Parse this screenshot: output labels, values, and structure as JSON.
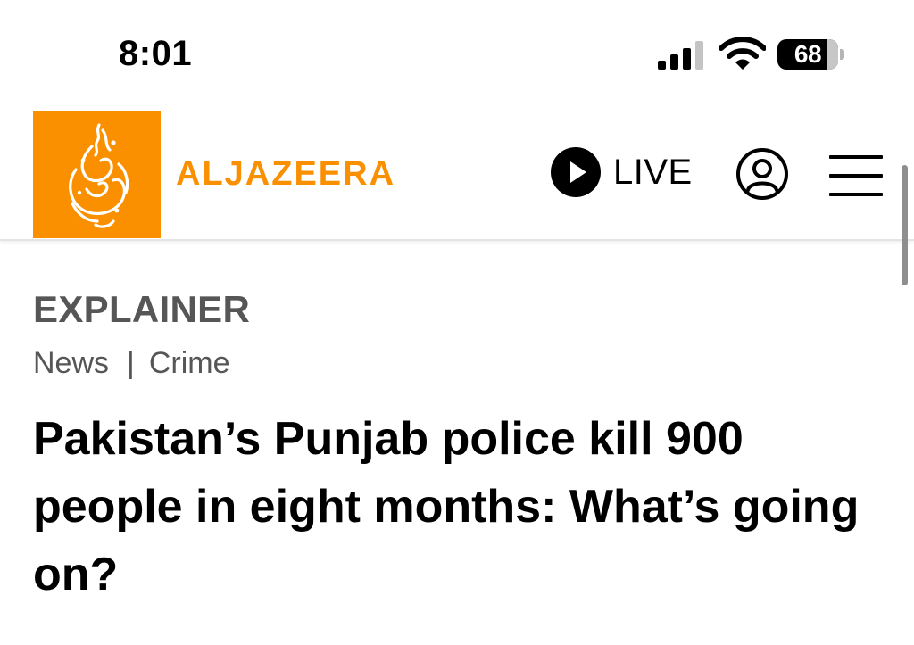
{
  "status_bar": {
    "time": "8:01",
    "battery_level": "68",
    "signal_bars_active": 3,
    "signal_bars_total": 4,
    "icons": [
      "cellular-signal-icon",
      "wifi-icon",
      "battery-icon"
    ]
  },
  "header": {
    "logo_text": "ALJAZEERA",
    "live_label": "LIVE",
    "icons": [
      "al-jazeera-calligraphy-logo",
      "play-icon",
      "account-icon",
      "hamburger-menu-icon"
    ]
  },
  "article": {
    "type_label": "EXPLAINER",
    "breadcrumb": [
      "News",
      "Crime"
    ],
    "breadcrumb_separator": "|",
    "headline": "Pakistan’s Punjab police kill 900 people in eight months: What’s going on?"
  },
  "colors": {
    "brand_orange": "#fa9000",
    "label_gray": "#565656",
    "text": "#000000"
  }
}
